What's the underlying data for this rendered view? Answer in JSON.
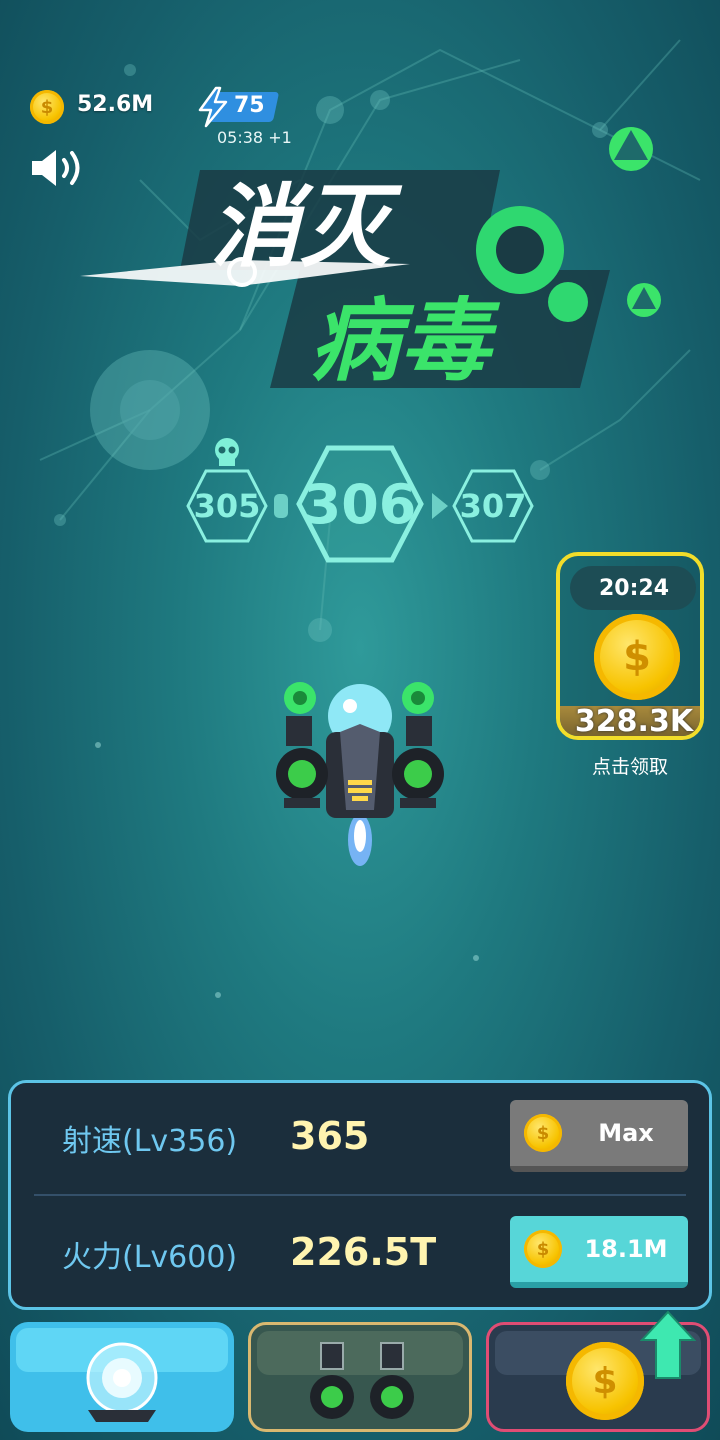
{
  "hud": {
    "coins": "52.6M",
    "energy": "75",
    "energy_timer": "05:38 +1"
  },
  "title": {
    "line1": "消灭",
    "line2": "病毒"
  },
  "levels": {
    "prev": "305",
    "current": "306",
    "next": "307"
  },
  "reward": {
    "timer": "20:24",
    "amount": "328.3K",
    "label": "点击领取"
  },
  "upgrades": {
    "fire_rate": {
      "label": "射速(Lv356)",
      "value": "365",
      "button": "Max"
    },
    "fire_power": {
      "label": "火力(Lv600)",
      "value": "226.5T",
      "button": "18.1M"
    }
  },
  "icons": {
    "currency": "coin-icon",
    "energy": "lightning-bolt-icon",
    "sound": "speaker-icon",
    "boss": "skull-icon",
    "upgrade_hint": "up-arrow-icon"
  },
  "colors": {
    "accent": "#8af0e0",
    "title_green": "#3be46a",
    "reward_border": "#f2dd2a",
    "panel_border": "#5cc4e6"
  }
}
